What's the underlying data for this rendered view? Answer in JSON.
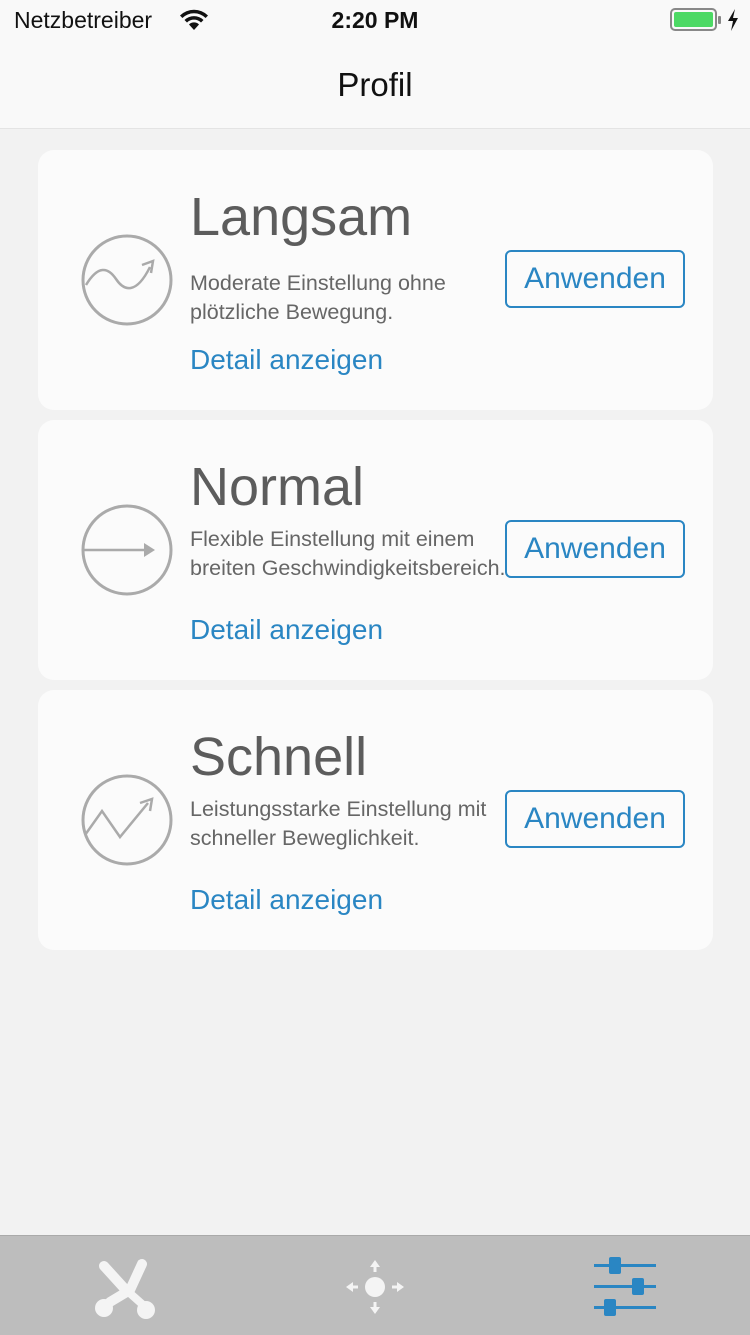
{
  "status_bar": {
    "carrier": "Netzbetreiber",
    "time": "2:20 PM",
    "battery_level": 1.0
  },
  "nav": {
    "title": "Profil"
  },
  "profiles": [
    {
      "title": "Langsam",
      "description": "Moderate Einstellung ohne plötzliche Bewegung.",
      "detail_label": "Detail anzeigen",
      "apply_label": "Anwenden",
      "icon": "wave-curve-icon"
    },
    {
      "title": "Normal",
      "description": "Flexible Einstellung mit einem breiten Geschwindigkeitsbereich.",
      "detail_label": "Detail anzeigen",
      "apply_label": "Anwenden",
      "icon": "straight-arrow-icon"
    },
    {
      "title": "Schnell",
      "description": "Leistungsstarke Einstellung mit schneller Beweglichkeit.",
      "detail_label": "Detail anzeigen",
      "apply_label": "Anwenden",
      "icon": "zigzag-arrow-icon"
    }
  ],
  "tab_bar": {
    "items": [
      {
        "icon": "gimbal-icon",
        "active": false
      },
      {
        "icon": "move-control-icon",
        "active": false
      },
      {
        "icon": "sliders-icon",
        "active": true
      }
    ]
  },
  "colors": {
    "accent": "#2a86c3",
    "background": "#f2f2f2",
    "card": "#fbfbfb",
    "tab_bar": "#bdbdbd",
    "battery": "#4cd964"
  }
}
